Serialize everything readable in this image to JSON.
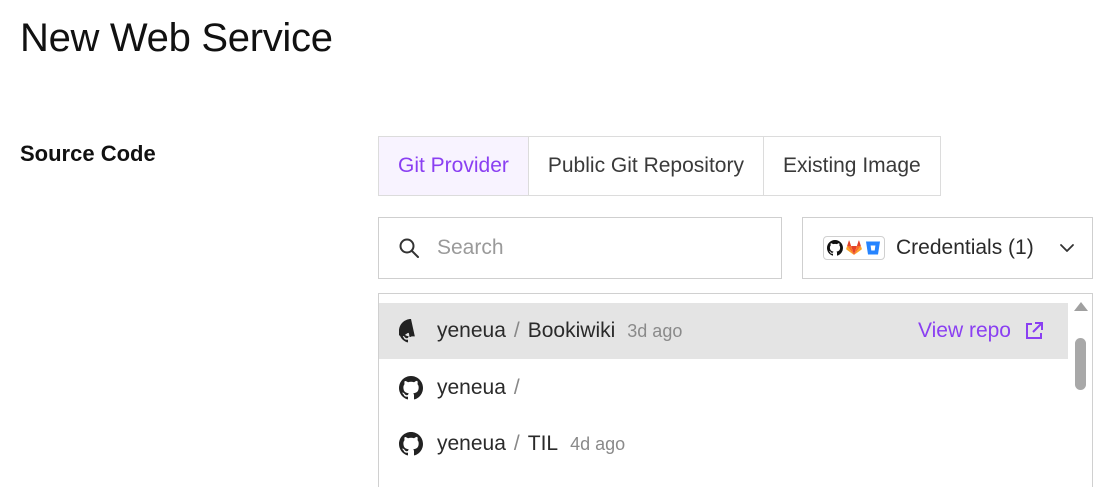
{
  "page": {
    "title": "New Web Service"
  },
  "source_code": {
    "label": "Source Code",
    "tabs": [
      {
        "label": "Git Provider",
        "active": true
      },
      {
        "label": "Public Git Repository",
        "active": false
      },
      {
        "label": "Existing Image",
        "active": false
      }
    ]
  },
  "search": {
    "placeholder": "Search",
    "value": "",
    "icon": "search-icon"
  },
  "credentials": {
    "label": "Credentials (1)",
    "icons": [
      "github-icon",
      "gitlab-icon",
      "bitbucket-icon"
    ]
  },
  "repos": [
    {
      "owner": "yeneua",
      "separator": "/",
      "name": "Bookiwiki",
      "age": "3d ago",
      "highlighted": true,
      "action": "View repo"
    },
    {
      "owner": "yeneua",
      "separator": "/",
      "name": "",
      "age": "",
      "highlighted": false
    },
    {
      "owner": "yeneua",
      "separator": "/",
      "name": "TIL",
      "age": "4d ago",
      "highlighted": false
    }
  ],
  "colors": {
    "accent": "#8a3ff2",
    "active_tab_bg": "#f8f3ff",
    "row_highlight": "#e4e4e4"
  }
}
